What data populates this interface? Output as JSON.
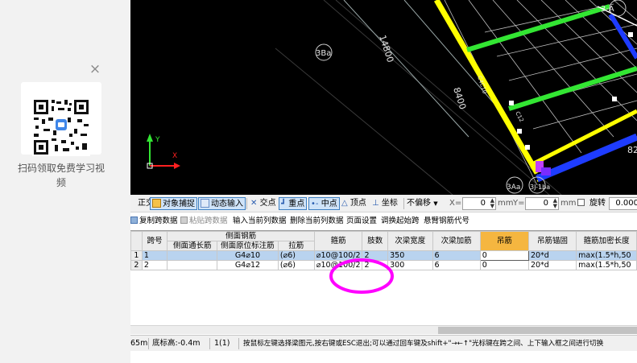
{
  "promo": {
    "close_glyph": "×",
    "text": "扫码领取免费学习视频"
  },
  "canvas": {
    "labels": {
      "grid_3ba": "3Ba",
      "dim_14800": "14800",
      "dim_8400": "8400",
      "grid_3a": "3-A",
      "grid_bottom_1": "3Aa",
      "grid_bottom_2": "3J-1ba",
      "small_rebar_1": "C4C10",
      "small_rebar_2": "C12",
      "partial_right": "82",
      "axis_y": "Y",
      "axis_x": "X"
    },
    "colors": {
      "background": "#000000",
      "beam_yellow": "#ffff00",
      "beam_green": "#33e633",
      "beam_blue": "#1e3cff",
      "beam_magenta": "#c040ff"
    }
  },
  "snapbar": {
    "ortho": "正交",
    "object_snap": "对象捕捉",
    "dynamic_input": "动态输入",
    "intersection": "交点",
    "midpoint_heavy": "重点",
    "midpoint": "中点",
    "vertex": "顶点",
    "coordinate": "坐标",
    "no_offset": "不偏移",
    "x_label": "X=",
    "x_value": "0",
    "unit_mm_1": "mm",
    "y_label": "Y=",
    "y_value": "0",
    "unit_mm_2": "mm",
    "rotate": "旋转",
    "rotate_value": "0.000"
  },
  "commands": {
    "copy_span": "复制跨数据",
    "paste_span": "粘贴跨数据",
    "input_column": "输入当前列数据",
    "delete_column": "删除当前列数据",
    "page_setup": "页面设置",
    "swap_start_span": "调换起始跨",
    "cantilever_code": "悬臂钢筋代号"
  },
  "table": {
    "headers": {
      "span_no": "跨号",
      "side_rebar_group": "侧面钢筋",
      "side_through": "侧面通长筋",
      "side_origin": "侧面原位标注筋",
      "tie": "拉筋",
      "stirrup": "箍筋",
      "legs": "肢数",
      "secondary_width": "次梁宽度",
      "secondary_add": "次梁加筋",
      "hanger": "吊筋",
      "hanger_anchor": "吊筋锚固",
      "stirrup_dense_len": "箍筋加密长度"
    },
    "rows": [
      {
        "row_no": "1",
        "span_no": "1",
        "side_through": "",
        "side_origin": "G4⌀10",
        "tie": "(⌀6)",
        "stirrup": "⌀10@100/2",
        "legs": "2",
        "secondary_width": "350",
        "secondary_add": "6",
        "hanger": "0",
        "hanger_anchor": "20*d",
        "stirrup_dense_len": "max(1.5*h,50"
      },
      {
        "row_no": "2",
        "span_no": "2",
        "side_through": "",
        "side_origin": "G4⌀12",
        "tie": "(⌀6)",
        "stirrup": "⌀10@100/2",
        "legs": "2",
        "secondary_width": "300",
        "secondary_add": "6",
        "hanger": "0",
        "hanger_anchor": "20*d",
        "stirrup_dense_len": "max(1.5*h,50"
      }
    ],
    "colors": {
      "selected_row": "#b9d3ef",
      "highlight_header": "#f5b640"
    }
  },
  "status": {
    "partial": "65m",
    "bottom_elev": "底标高:-0.4m",
    "span_info": "1(1)",
    "hint": "按鼠标左键选择梁图元,按右键或ESC退出;可以通过回车键及shift+\"→←↑\"光标键在跨之间、上下输入框之间进行切换"
  },
  "annotation": {
    "color": "#ff00ff"
  }
}
